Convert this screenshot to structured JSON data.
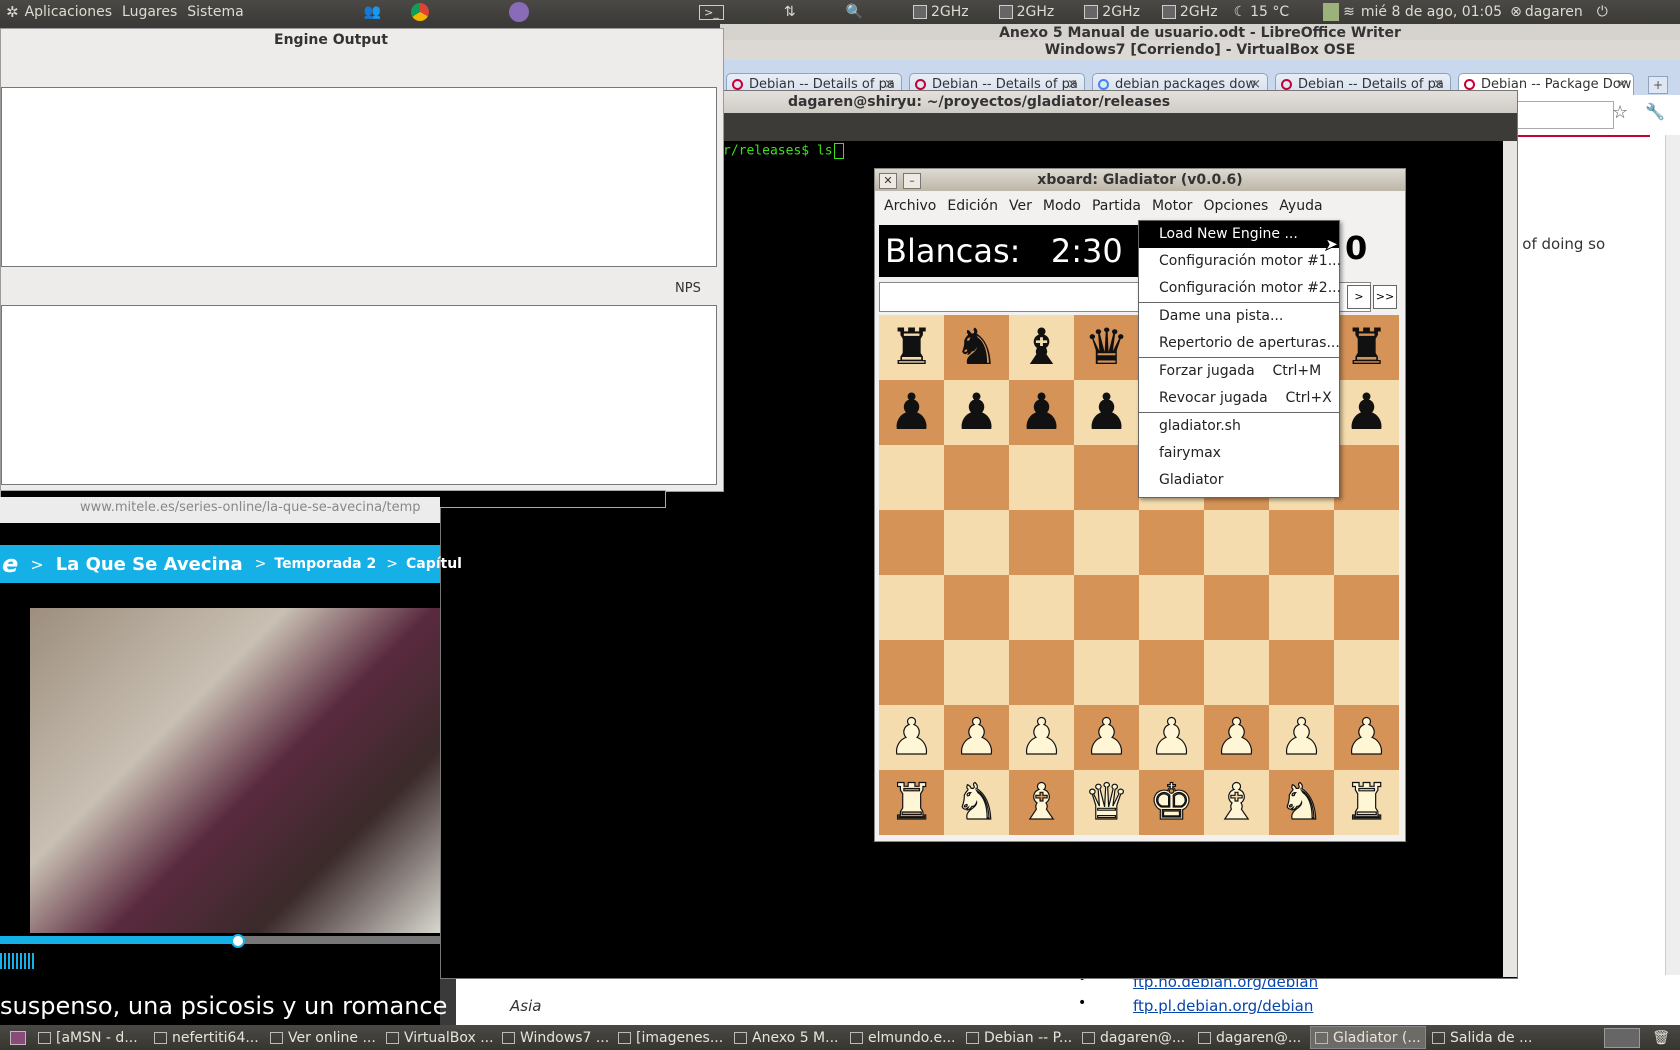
{
  "top_panel": {
    "menus": [
      "Aplicaciones",
      "Lugares",
      "Sistema"
    ],
    "cpu_freqs": [
      "2GHz",
      "2GHz",
      "2GHz",
      "2GHz"
    ],
    "weather": "15 °C",
    "datetime": "mié  8 de ago, 01:05",
    "user": "dagaren"
  },
  "writer": {
    "title": "Anexo 5 Manual de usuario.odt - LibreOffice Writer"
  },
  "vbox": {
    "title": "Windows7 [Corriendo] - VirtualBox OSE"
  },
  "browser": {
    "tabs": [
      "Debian -- Details of pa",
      "Debian -- Details of pa",
      "debian packages dow",
      "Debian -- Details of pa",
      "Debian -- Package Dow"
    ],
    "page_text": "d of doing so",
    "links": [
      "ftp.no.debian.org/debian",
      "ftp.pl.debian.org/debian"
    ],
    "region_label": "Asia"
  },
  "terminal": {
    "title": "dagaren@shiryu: ~/proyectos/gladiator/releases",
    "prompt": "r/releases$ ls"
  },
  "engine_output": {
    "title": "Engine Output",
    "nps_label": "NPS"
  },
  "video": {
    "url": "www.mitele.es/series-online/la-que-se-avecina/temp",
    "breadcrumb": [
      ">",
      "La Que Se Avecina",
      ">",
      "Temporada 2",
      ">",
      "Capítul"
    ],
    "subtitle": "suspenso, una psicosis y un romance"
  },
  "xboard": {
    "title": "xboard: Gladiator (v0.0.6)",
    "menu": [
      "Archivo",
      "Edición",
      "Ver",
      "Modo",
      "Partida",
      "Motor",
      "Opciones",
      "Ayuda"
    ],
    "white_clock": "Blancas:   2:30",
    "black_clock_fragment": "0",
    "nav_buttons": [
      ">",
      ">>"
    ],
    "board": [
      [
        "r",
        "n",
        "b",
        "q",
        "",
        "",
        "",
        "r"
      ],
      [
        "p",
        "p",
        "p",
        "p",
        "",
        "",
        "",
        "p"
      ],
      [
        "",
        "",
        "",
        "",
        "",
        "",
        "",
        ""
      ],
      [
        "",
        "",
        "",
        "",
        "",
        "",
        "",
        ""
      ],
      [
        "",
        "",
        "",
        "",
        "",
        "",
        "",
        ""
      ],
      [
        "",
        "",
        "",
        "",
        "",
        "",
        "",
        ""
      ],
      [
        "P",
        "P",
        "P",
        "P",
        "P",
        "P",
        "P",
        "P"
      ],
      [
        "R",
        "N",
        "B",
        "Q",
        "K",
        "B",
        "N",
        "R"
      ]
    ]
  },
  "motor_menu": {
    "items": [
      {
        "label": "Load New Engine ...",
        "selected": true,
        "sep_after": false
      },
      {
        "label": "Configuración motor #1...",
        "selected": false,
        "sep_after": false
      },
      {
        "label": "Configuración motor #2...",
        "selected": false,
        "sep_after": true
      },
      {
        "label": "Dame una pista...",
        "selected": false,
        "sep_after": false
      },
      {
        "label": "Repertorio de aperturas...",
        "selected": false,
        "sep_after": true
      },
      {
        "label": "Forzar jugada    Ctrl+M",
        "selected": false,
        "sep_after": false
      },
      {
        "label": "Revocar jugada    Ctrl+X",
        "selected": false,
        "sep_after": true
      },
      {
        "label": "gladiator.sh",
        "selected": false,
        "sep_after": false
      },
      {
        "label": "fairymax",
        "selected": false,
        "sep_after": false
      },
      {
        "label": "Gladiator",
        "selected": false,
        "sep_after": false
      }
    ]
  },
  "taskbar": {
    "tasks": [
      "[aMSN - d...",
      "nefertiti64...",
      "Ver online ...",
      "VirtualBox ...",
      "Windows7 ...",
      "[imagenes...",
      "Anexo 5 M...",
      "elmundo.e...",
      "Debian -- P...",
      "dagaren@...",
      "dagaren@...",
      "Gladiator (...",
      "Salida de ..."
    ],
    "active_index": 11
  },
  "colors": {
    "panel": "#3c3b37",
    "board_light": "#f4dcae",
    "board_dark": "#d69358",
    "terminal_text": "#3fe01e",
    "video_nav": "#15b0e6"
  }
}
